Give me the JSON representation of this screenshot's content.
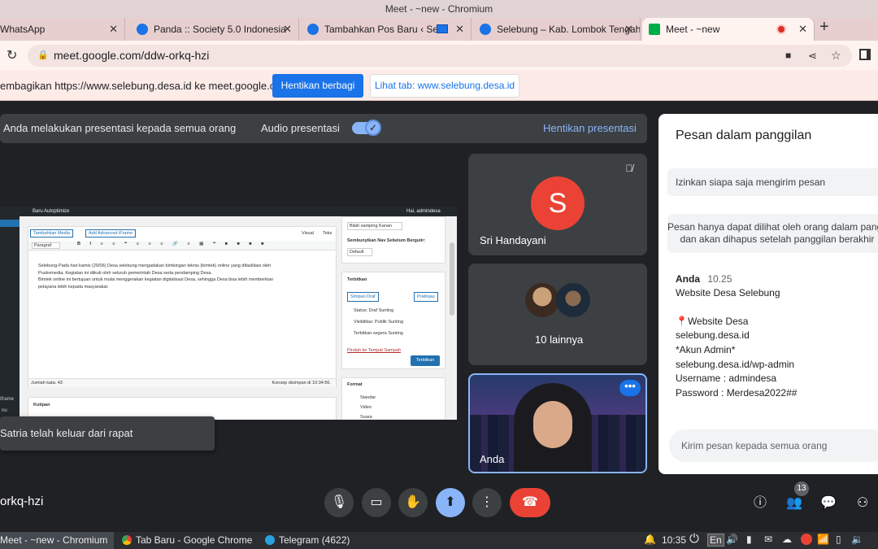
{
  "window": {
    "title": "Meet - ~new - Chromium"
  },
  "tabs": [
    {
      "label": "WhatsApp",
      "color": "#25d366"
    },
    {
      "label": "Panda :: Society 5.0 Indonesia",
      "color": "#1a73e8"
    },
    {
      "label": "Tambahkan Pos Baru ‹ Sele",
      "color": "#1a73e8"
    },
    {
      "label": "Selebung – Kab. Lombok Tengah",
      "color": "#1a73e8"
    },
    {
      "label": "Meet - ~new",
      "color": "#00ac47"
    }
  ],
  "address": {
    "url": "meet.google.com/ddw-orkq-hzi"
  },
  "infobar": {
    "message": "embagikan https://www.selebung.desa.id ke meet.google.com",
    "stop_label": "Hentikan berbagi",
    "view_label": "Lihat tab: www.selebung.desa.id"
  },
  "presenting": {
    "message": "Anda melakukan presentasi kepada semua orang",
    "audio_label": "Audio presentasi",
    "stop_label": "Hentikan presentasi"
  },
  "shared_screen": {
    "adminbar": "Baru   Autoptimize",
    "admin_user": "Hai, admindesa",
    "add_media": "Tambahkan Media",
    "add_iframe": "Add Advanced iFrame",
    "tab_visual": "Visual",
    "tab_text": "Teks",
    "paragraph": "Paragraf",
    "body_lines": [
      "Selebung-Pada hari kamis (29/06) Desa selebung mengadakan bimbingan teknis (bimtek) online yang difasilitasi oleh",
      "Puskomedia. Kegiatan ini diikuti oleh seluruh pemerintah Desa serta pendamping Desa.",
      "Bimtek online ini bertujuan untuk mulai menggerakan kegiatan digitalisasi Desa, sehingga Desa bisa lebih memberikan",
      "pelayana lebih kepada masyarakat."
    ],
    "word_count": "Jumlah kata: 43",
    "draft_saved": "Konsep disimpan di 10:34:56.",
    "sidebar_select": "Bilah samping Kanan",
    "hide_nav": "Sembunyikan Nav Sebelum Berguiir:",
    "default_opt": "Default",
    "publish_title": "Terbitkan",
    "save_draft": "Simpan Draf",
    "preview": "Pratinjau",
    "status": "Status: Draf  Sunting",
    "visibility": "Visibilitas: Publik  Sunting",
    "publish_time": "Terbitkan segera  Sunting",
    "trash": "Pindah ke Tempat Sampah",
    "publish_btn": "Terbitkan",
    "format_title": "Format",
    "format_options": [
      "Standar",
      "Video",
      "Suara"
    ],
    "excerpt_title": "Kutipan",
    "left_items": [
      "Iframe",
      "nu"
    ]
  },
  "toast": {
    "message": "Satria telah keluar dari rapat"
  },
  "participants": {
    "sri": {
      "initial": "S",
      "name": "Sri Handayani"
    },
    "others": {
      "label": "10 lainnya"
    },
    "self": {
      "name": "Anda"
    }
  },
  "chat": {
    "title": "Pesan dalam panggilan",
    "allow_label": "Izinkan siapa saja mengirim pesan",
    "note_line1": "Pesan hanya dapat dilihat oleh orang dalam pangg",
    "note_line2": "dan akan dihapus setelah panggilan berakhir",
    "sender": "Anda",
    "time": "10.25",
    "lines": [
      "Website Desa Selebung",
      "",
      "📍Website Desa",
      "selebung.desa.id",
      " *Akun Admin*",
      "selebung.desa.id/wp-admin",
      "Username : admindesa",
      "Password : Merdesa2022##"
    ],
    "input_placeholder": "Kirim pesan kepada semua orang"
  },
  "controls": {
    "meeting_code": "orkq-hzi",
    "people_count": "13"
  },
  "taskbar": {
    "items": [
      "Meet - ~new - Chromium",
      "Tab Baru - Google Chrome",
      "Telegram (4622)"
    ],
    "clock": "10:35",
    "lang": "En"
  }
}
